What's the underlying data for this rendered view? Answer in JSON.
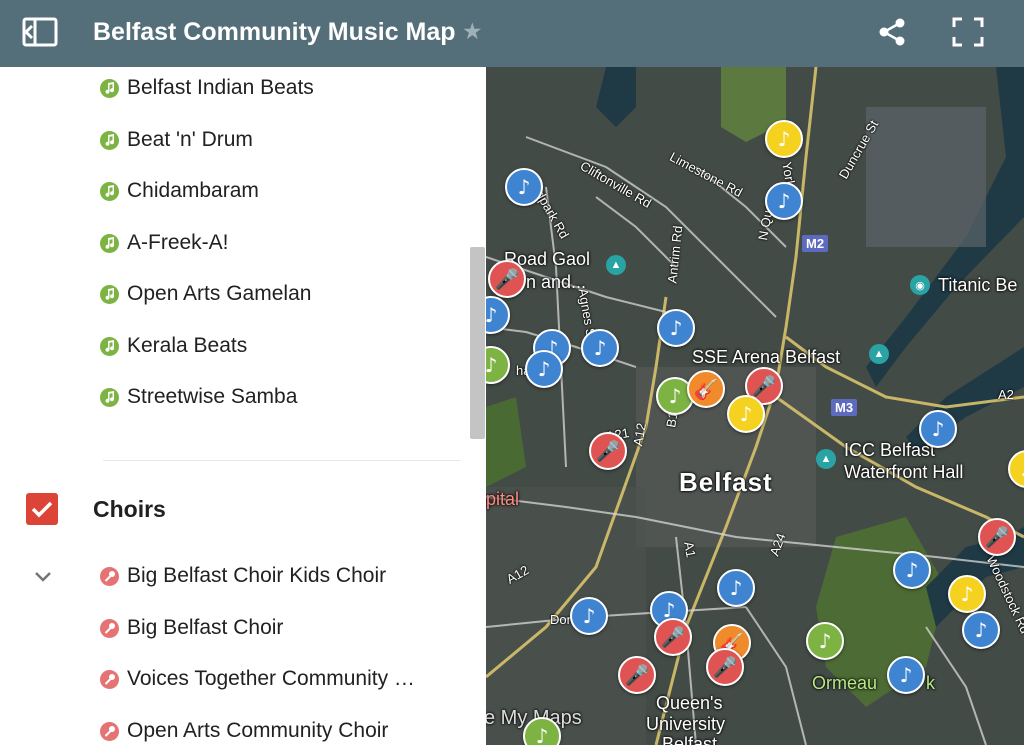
{
  "header": {
    "title": "Belfast Community Music Map",
    "star_icon": "★"
  },
  "layers": {
    "drumming_items": [
      {
        "label": "Belfast Indian Beats",
        "icon": "music-note-icon"
      },
      {
        "label": "Beat 'n' Drum",
        "icon": "music-note-icon"
      },
      {
        "label": "Chidambaram",
        "icon": "music-note-icon"
      },
      {
        "label": "A-Freek-A!",
        "icon": "music-note-icon"
      },
      {
        "label": "Open Arts Gamelan",
        "icon": "music-note-icon"
      },
      {
        "label": "Kerala Beats",
        "icon": "music-note-icon"
      },
      {
        "label": "Streetwise Samba",
        "icon": "music-note-icon"
      }
    ],
    "choirs": {
      "title": "Choirs",
      "checked": true,
      "items": [
        {
          "label": "Big Belfast Choir Kids Choir",
          "icon": "microphone-icon"
        },
        {
          "label": "Big Belfast Choir",
          "icon": "microphone-icon"
        },
        {
          "label": "Voices Together Community …",
          "icon": "microphone-icon"
        },
        {
          "label": "Open Arts Community Choir",
          "icon": "microphone-icon"
        }
      ]
    }
  },
  "map": {
    "labels": {
      "belfast": "Belfast",
      "sse_arena": "SSE Arena Belfast",
      "titanic": "Titanic Be",
      "icc_line1": "ICC Belfast",
      "icc_line2": "Waterfront Hall",
      "gaol_line1": "Road Gaol",
      "gaol_line2": "n and...",
      "queens_line1": "Queen's",
      "queens_line2": "University",
      "queens_line3": "Belfast",
      "ormeau": "Ormeau",
      "ormeau_suffix": "k",
      "hospital": "pital",
      "watermark": "e My Maps"
    },
    "roads": {
      "limestone": "Limestone Rd",
      "cliftonville": "Cliftonville Rd",
      "antrim": "Antrim Rd",
      "duncrue": "Duncrue St",
      "northqueen": "N Queen",
      "york": "York",
      "oldpark": "dpark Rd",
      "agnes": "Agnes St",
      "a12": "A12",
      "a12b": "A12",
      "b1": "B1",
      "a1": "A1",
      "a24": "A24",
      "a2": "A2",
      "a21": "A21",
      "donegall": "Don",
      "woodstock": "Woodstock Rd",
      "shankill": "hank"
    },
    "badges": {
      "m2": "M2",
      "m3": "M3"
    },
    "colors": {
      "blue": "#3f84d1",
      "yellow": "#f4d21f",
      "red": "#e05353",
      "green": "#7cb342",
      "orange": "#f08a2a"
    }
  }
}
